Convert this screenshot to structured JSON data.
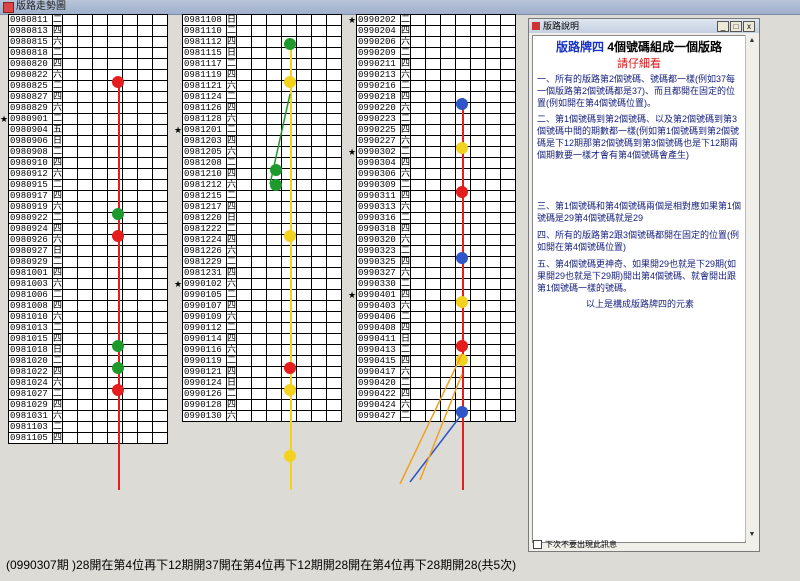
{
  "window_title": "版路走勢圖",
  "panels": [
    {
      "dates": [
        "0980811",
        "0980813",
        "0980815",
        "0980818",
        "0980820",
        "0980822",
        "0980825",
        "0980827",
        "0980829",
        "0980901",
        "0980904",
        "0980906",
        "0980908",
        "0980910",
        "0980912",
        "0980915",
        "0980917",
        "0980919",
        "0980922",
        "0980924",
        "0980926",
        "0980927",
        "0980929",
        "0981001",
        "0981003",
        "0981006",
        "0981008",
        "0981010",
        "0981013",
        "0981015",
        "0981018",
        "0981020",
        "0981022",
        "0981024",
        "0981027",
        "0981029",
        "0981031",
        "0981103",
        "0981105"
      ],
      "days": [
        "二",
        "四",
        "六",
        "二",
        "四",
        "六",
        "二",
        "四",
        "六",
        "二",
        "五",
        "日",
        "二",
        "四",
        "六",
        "二",
        "四",
        "六",
        "二",
        "四",
        "六",
        "日",
        "二",
        "四",
        "六",
        "二",
        "四",
        "六",
        "二",
        "四",
        "日",
        "二",
        "四",
        "六",
        "二",
        "四",
        "六",
        "二",
        "四"
      ],
      "stars": [
        false,
        false,
        false,
        false,
        false,
        false,
        false,
        false,
        false,
        true,
        false,
        false,
        false,
        false,
        false,
        false,
        false,
        false,
        false,
        false,
        false,
        false,
        false,
        false,
        false,
        false,
        false,
        false,
        false,
        false,
        false,
        false,
        false,
        false,
        false,
        false,
        false,
        false,
        false
      ]
    },
    {
      "dates": [
        "0981108",
        "0981110",
        "0981112",
        "0981115",
        "0981117",
        "0981119",
        "0981121",
        "0981124",
        "0981126",
        "0981128",
        "0981201",
        "0981203",
        "0981205",
        "0981208",
        "0981210",
        "0981212",
        "0981215",
        "0981217",
        "0981220",
        "0981222",
        "0981224",
        "0981226",
        "0981229",
        "0981231",
        "0990102",
        "0990105",
        "0990107",
        "0990109",
        "0990112",
        "0990114",
        "0990116",
        "0990119",
        "0990121",
        "0990124",
        "0990126",
        "0990128",
        "0990130"
      ],
      "days": [
        "日",
        "二",
        "四",
        "日",
        "二",
        "四",
        "六",
        "二",
        "四",
        "六",
        "二",
        "四",
        "六",
        "二",
        "四",
        "六",
        "二",
        "四",
        "日",
        "二",
        "四",
        "六",
        "二",
        "四",
        "六",
        "二",
        "四",
        "六",
        "二",
        "四",
        "六",
        "二",
        "四",
        "日",
        "二",
        "四",
        "六"
      ],
      "stars": [
        false,
        false,
        false,
        false,
        false,
        false,
        false,
        false,
        false,
        false,
        true,
        false,
        false,
        false,
        false,
        false,
        false,
        false,
        false,
        false,
        false,
        false,
        false,
        false,
        true,
        false,
        false,
        false,
        false,
        false,
        false,
        false,
        false,
        false,
        false,
        false,
        false
      ]
    },
    {
      "dates": [
        "0990202",
        "0990204",
        "0990206",
        "0990209",
        "0990211",
        "0990213",
        "0990216",
        "0990218",
        "0990220",
        "0990223",
        "0990225",
        "0990227",
        "0990302",
        "0990304",
        "0990306",
        "0990309",
        "0990311",
        "0990313",
        "0990316",
        "0990318",
        "0990320",
        "0990323",
        "0990325",
        "0990327",
        "0990330",
        "0990401",
        "0990403",
        "0990406",
        "0990408",
        "0990411",
        "0990413",
        "0990415",
        "0990417",
        "0990420",
        "0990422",
        "0990424",
        "0990427"
      ],
      "days": [
        "二",
        "四",
        "六",
        "二",
        "四",
        "六",
        "二",
        "四",
        "六",
        "二",
        "四",
        "六",
        "二",
        "四",
        "六",
        "二",
        "四",
        "六",
        "二",
        "四",
        "六",
        "二",
        "四",
        "六",
        "二",
        "四",
        "六",
        "二",
        "四",
        "日",
        "二",
        "四",
        "六",
        "二",
        "四",
        "六",
        "二"
      ],
      "stars": [
        true,
        false,
        false,
        false,
        false,
        false,
        false,
        false,
        false,
        false,
        false,
        false,
        true,
        false,
        false,
        false,
        false,
        false,
        false,
        false,
        false,
        false,
        false,
        false,
        false,
        true,
        false,
        false,
        false,
        false,
        false,
        false,
        false,
        false,
        false,
        false,
        false
      ]
    }
  ],
  "dialog": {
    "title": "版路說明",
    "heading_a": "版路牌四",
    "heading_b": "4個號碼組成一個版路",
    "subheading": "請仔細看",
    "paragraphs": [
      "一、所有的版路第2個號碼、號碼都一樣(例如37每一個版路第2個號碼都是37)、而且都開在固定的位置(例如開在第4個號碼位置)。",
      "二、第1個號碼到第2個號碼、以及第2個號碼到第3個號碼中間的期數都一樣(例如第1個號碼到第2個號碼是下12期那第2個號碼到第3個號碼也是下12期兩個期數要一樣才會有第4個號碼會產生)",
      "三、第1個號碼和第4個號碼兩個是相對應如果第1個號碼是29第4個號碼就是29",
      "四、所有的版路第2跟3個號碼都開在固定的位置(例如開在第4個號碼位置)",
      "五、第4個號碼更神奇、如果開29也就是下29期(如果開29也就是下29期)開出第4個號碼、就會開出跟第1個號碼一樣的號碼。",
      "以上是構成版路牌四的元素"
    ],
    "checkbox_label": "下次不要出現此訊息"
  },
  "status_text": "(0990307期 )28開在第4位再下12期開37開在第4位再下12期開28開在第4位再下28期開28(共5次)",
  "colors": {
    "red": "#e41d1d",
    "green": "#1d9a2b",
    "yellow": "#f2d21c",
    "blue": "#2f56c9",
    "orange": "#f0a020",
    "title_blue": "#1833c8",
    "subtitle_red": "#d51616"
  }
}
